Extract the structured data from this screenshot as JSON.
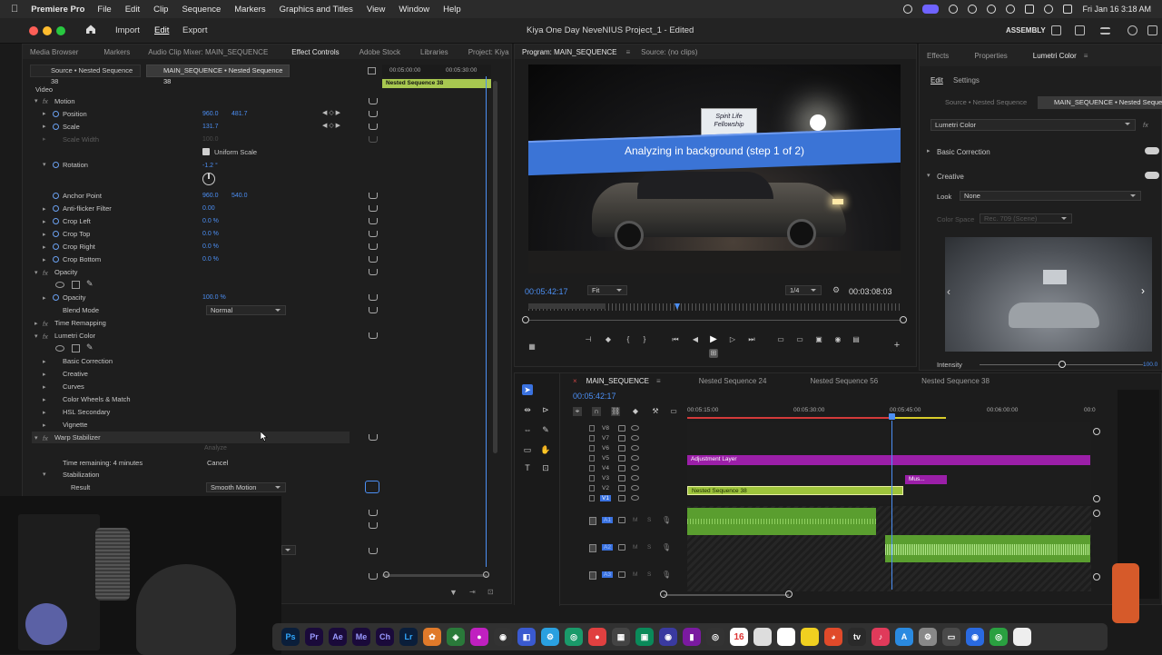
{
  "menubar": {
    "app_name": "Premiere Pro",
    "items": [
      "File",
      "Edit",
      "Clip",
      "Sequence",
      "Markers",
      "Graphics and Titles",
      "View",
      "Window",
      "Help"
    ],
    "datetime": "Fri Jan 16  3:18 AM"
  },
  "app_header": {
    "workspace_tabs": [
      "Import",
      "Edit",
      "Export"
    ],
    "project_title": "Kiya One Day NeveNIUS Project_1 - Edited",
    "workspace_label": "ASSEMBLY"
  },
  "left_panel": {
    "tabs": [
      "Media Browser",
      "Markers",
      "Audio Clip Mixer: MAIN_SEQUENCE",
      "Effect Controls",
      "Adobe Stock",
      "Libraries",
      "Project: Kiya"
    ],
    "source_label": "Source • Nested Sequence 38",
    "target_label": "MAIN_SEQUENCE • Nested Sequence 38",
    "mini_timecodes": [
      "00:05:00:00",
      "00:05:30:00"
    ],
    "mini_clip_label": "Nested Sequence 38",
    "section_video": "Video",
    "motion": {
      "label": "Motion",
      "position": {
        "label": "Position",
        "x": "960.0",
        "y": "481.7"
      },
      "scale": {
        "label": "Scale",
        "value": "131.7"
      },
      "scale_width": {
        "label": "Scale Width",
        "value": "100.0"
      },
      "uniform_scale": "Uniform Scale",
      "rotation": {
        "label": "Rotation",
        "value": "-1.2 °"
      },
      "anchor_point": {
        "label": "Anchor Point",
        "x": "960.0",
        "y": "540.0"
      },
      "anti_flicker": {
        "label": "Anti-flicker Filter",
        "value": "0.00"
      },
      "crop_left": {
        "label": "Crop Left",
        "value": "0.0 %"
      },
      "crop_top": {
        "label": "Crop Top",
        "value": "0.0 %"
      },
      "crop_right": {
        "label": "Crop Right",
        "value": "0.0 %"
      },
      "crop_bottom": {
        "label": "Crop Bottom",
        "value": "0.0 %"
      }
    },
    "opacity": {
      "label": "Opacity",
      "opacity_row": {
        "label": "Opacity",
        "value": "100.0 %"
      },
      "blend_mode": {
        "label": "Blend Mode",
        "value": "Normal"
      }
    },
    "time_remapping": "Time Remapping",
    "lumetri": {
      "label": "Lumetri Color",
      "items": [
        "Basic Correction",
        "Creative",
        "Curves",
        "Color Wheels & Match",
        "HSL Secondary",
        "Vignette"
      ]
    },
    "warp": {
      "label": "Warp Stabilizer",
      "analyze": "Analyze",
      "time_remaining": "Time remaining: 4 minutes",
      "cancel": "Cancel",
      "stabilization": "Stabilization",
      "result_label": "Result",
      "result_value": "Smooth Motion"
    }
  },
  "program_monitor": {
    "tabs": [
      "Program: MAIN_SEQUENCE",
      "Source: (no clips)"
    ],
    "overlay_text": "Analyzing in background (step 1 of 2)",
    "sign_text_1": "Spirit Life",
    "sign_text_2": "Fellowship",
    "timecode": "00:05:42:17",
    "fit": "Fit",
    "resolution": "1/4",
    "duration": "00:03:08:03"
  },
  "right_panel": {
    "tabs": [
      "Effects",
      "Properties",
      "Lumetri Color"
    ],
    "subtabs": [
      "Edit",
      "Settings"
    ],
    "source_label": "Source • Nested Sequence",
    "target_label": "MAIN_SEQUENCE • Nested Sequence",
    "effect_select": "Lumetri Color",
    "basic_correction": "Basic Correction",
    "creative": "Creative",
    "look_label": "Look",
    "look_value": "None",
    "color_space_label": "Color Space",
    "color_space_value": "Rec. 709 (Scene)",
    "intensity_label": "Intensity",
    "intensity_value": "100.0"
  },
  "timeline": {
    "tabs": [
      "MAIN_SEQUENCE",
      "Nested Sequence 24",
      "Nested Sequence 56",
      "Nested Sequence 38"
    ],
    "timecode": "00:05:42:17",
    "ruler": [
      "00:05:15:00",
      "00:05:30:00",
      "00:05:45:00",
      "00:06:00:00",
      "00:0"
    ],
    "video_tracks": [
      "V8",
      "V7",
      "V6",
      "V5",
      "V4",
      "V3",
      "V2",
      "V1"
    ],
    "audio_tracks": [
      "A1",
      "A2",
      "A3"
    ],
    "clips": {
      "adjustment": "Adjustment Layer",
      "mus": "Mus...",
      "nested": "Nested Sequence 38"
    }
  },
  "dock": {
    "apps": [
      "Ps",
      "Pr",
      "Ae",
      "Me",
      "Ch",
      "Lr"
    ],
    "calendar_day": "16"
  },
  "colors": {
    "accent_blue": "#4c8ff4",
    "clip_purple": "#9b1fa8",
    "clip_green": "#9ec43c",
    "audio_green": "#5a9e2f"
  }
}
